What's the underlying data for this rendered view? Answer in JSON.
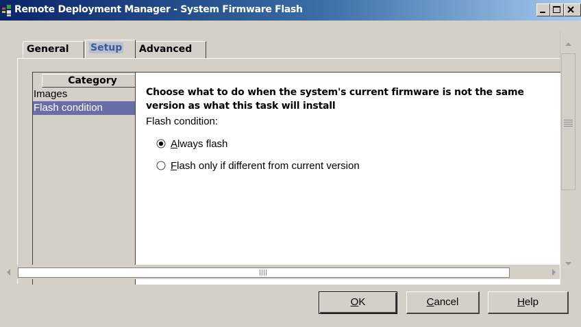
{
  "window": {
    "title": "Remote Deployment Manager - System Firmware Flash",
    "title_bar_gradient": [
      "#0a246a",
      "#a6caf0"
    ]
  },
  "caption_buttons": [
    "minimize-icon",
    "maximize-icon",
    "close-icon"
  ],
  "tabs": [
    {
      "label": "General",
      "selected": false
    },
    {
      "label": "Setup",
      "selected": true
    },
    {
      "label": "Advanced",
      "selected": false
    }
  ],
  "category": {
    "header": "Category",
    "items": [
      {
        "label": "Images",
        "selected": false
      },
      {
        "label": "Flash condition",
        "selected": true
      }
    ],
    "selection_color": "#6a6ea8"
  },
  "detail": {
    "heading": "Choose what to do when the system's current firmware is not the same version as what this task will install",
    "condition_label": "Flash condition:",
    "options": [
      {
        "mnemonic": "A",
        "rest": "lways flash",
        "checked": true
      },
      {
        "mnemonic": "F",
        "rest": "lash only if different from current version",
        "checked": false
      }
    ]
  },
  "buttons": {
    "ok": {
      "mnemonic": "O",
      "rest": "K"
    },
    "cancel": {
      "mnemonic": "C",
      "rest": "ancel"
    },
    "help": {
      "mnemonic": "H",
      "rest": "elp"
    }
  }
}
